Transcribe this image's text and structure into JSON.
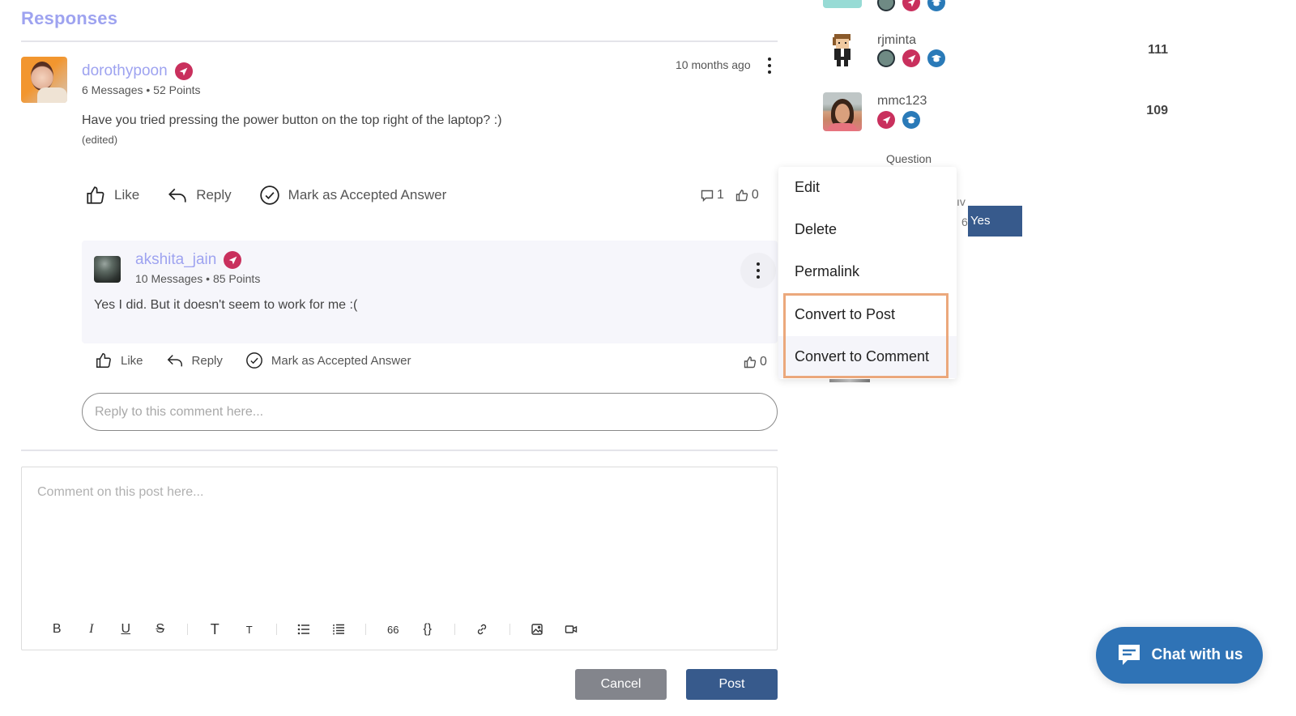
{
  "responses": {
    "title": "Responses",
    "post": {
      "author": "dorothypoon",
      "meta": "6 Messages • 52 Points",
      "timestamp": "10 months ago",
      "body": "Have you tried pressing the power button on the top right of the laptop? :)",
      "edited_label": "(edited)",
      "actions": {
        "like": "Like",
        "reply": "Reply",
        "accept": "Mark as Accepted Answer"
      },
      "comment_count": "1",
      "like_count": "0"
    },
    "reply": {
      "author": "akshita_jain",
      "meta": "10 Messages • 85 Points",
      "body": "Yes I did. But it doesn't seem to work for me :(",
      "actions": {
        "like": "Like",
        "reply": "Reply",
        "accept": "Mark as Accepted Answer"
      },
      "like_count": "0"
    },
    "reply_input": {
      "placeholder": "Reply to this comment here...",
      "value": ""
    }
  },
  "editor": {
    "placeholder": "Comment on this post here...",
    "value": "",
    "toolbar": [
      {
        "name": "bold",
        "glyph": "B"
      },
      {
        "name": "italic",
        "glyph": "I"
      },
      {
        "name": "underline",
        "glyph": "U"
      },
      {
        "name": "strikethrough",
        "glyph": "S"
      },
      {
        "name": "heading-large",
        "glyph": "T"
      },
      {
        "name": "heading-small",
        "glyph": "T"
      },
      {
        "name": "bulleted-list",
        "glyph": "☰"
      },
      {
        "name": "numbered-list",
        "glyph": "☰"
      },
      {
        "name": "quote",
        "glyph": "66"
      },
      {
        "name": "code",
        "glyph": "{}"
      },
      {
        "name": "link",
        "glyph": "link"
      },
      {
        "name": "image",
        "glyph": "image"
      },
      {
        "name": "video",
        "glyph": "video"
      }
    ],
    "cancel_label": "Cancel",
    "post_label": "Post"
  },
  "leaderboard": {
    "users": [
      {
        "name": "rjminta",
        "score": "111",
        "badges": [
          "globe",
          "send",
          "graduation"
        ]
      },
      {
        "name": "mmc123",
        "score": "109",
        "badges": [
          "send",
          "graduation"
        ]
      }
    ],
    "peek_question": "Question",
    "peek_letters": "ıv",
    "peek_six": "6",
    "peek_yes": "Yes"
  },
  "context_menu": {
    "items": [
      "Edit",
      "Delete",
      "Permalink",
      "Convert to Post",
      "Convert to Comment"
    ],
    "highlight_color": "#eba87c"
  },
  "chat": {
    "label": "Chat with us",
    "color": "#2f73b6"
  },
  "colors": {
    "username": "#9ea3f0",
    "primary_button": "#375a8c",
    "cancel_button": "#83858c",
    "send_badge": "#c9305d",
    "edu_badge": "#2a7ab8"
  }
}
